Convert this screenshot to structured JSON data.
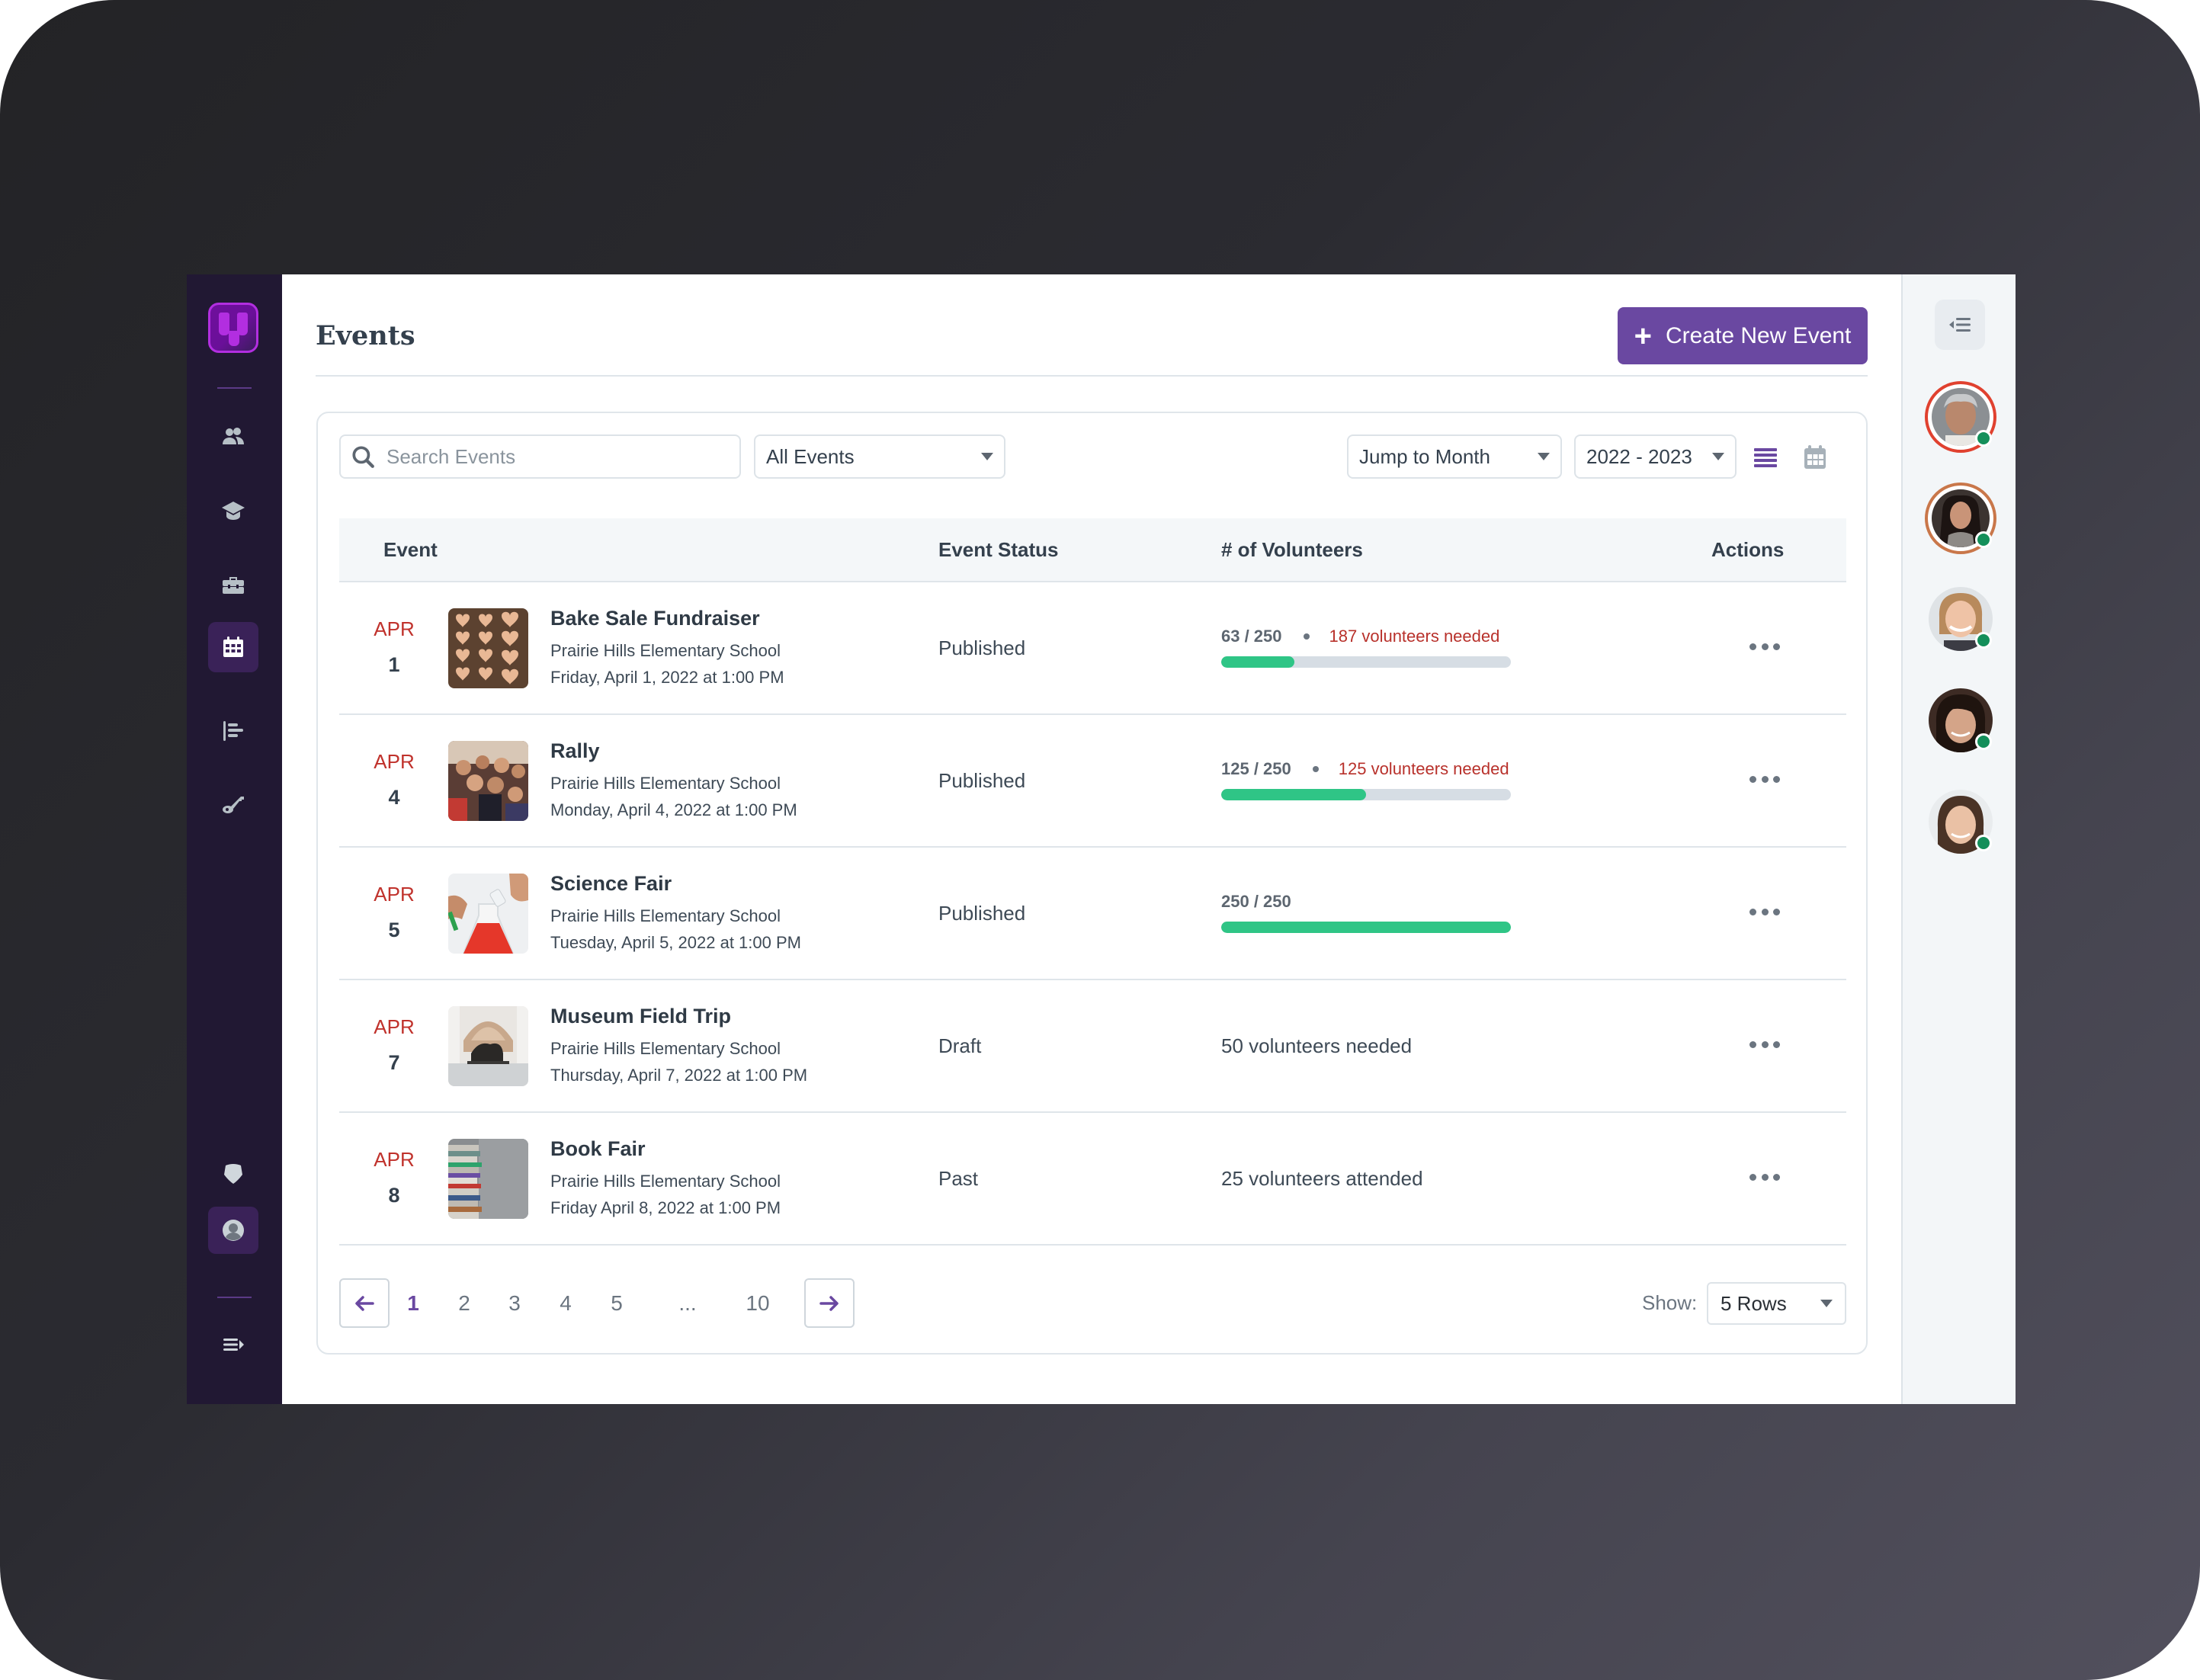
{
  "colors": {
    "sidebar_bg": "#211833",
    "brand_purple": "#6a48a1",
    "logo_magenta": "#b22ee0",
    "need_red": "#b8312b",
    "progress_green": "#2fc586",
    "online_green": "#148f5a",
    "date_month_red": "#c0322c"
  },
  "sidebar": {
    "logo": "brand-logo",
    "items": [
      {
        "name": "users",
        "icon": "users-icon",
        "active": false
      },
      {
        "name": "education",
        "icon": "graduation-cap-icon",
        "active": false
      },
      {
        "name": "jobs",
        "icon": "briefcase-icon",
        "active": false
      },
      {
        "name": "events",
        "icon": "calendar-icon",
        "active": true
      },
      {
        "name": "reports",
        "icon": "align-left-icon",
        "active": false
      },
      {
        "name": "keys",
        "icon": "key-icon",
        "active": false
      }
    ],
    "bottom_items": [
      {
        "name": "security",
        "icon": "shield-icon"
      },
      {
        "name": "profile",
        "icon": "user-circle-icon",
        "active": true
      },
      {
        "name": "expand",
        "icon": "expand-menu-icon"
      }
    ]
  },
  "header": {
    "title": "Events",
    "create_button": "Create New Event"
  },
  "toolbar": {
    "search_placeholder": "Search Events",
    "search_value": "",
    "filter_selected": "All Events",
    "jump_month": "Jump to Month",
    "year_selected": "2022 - 2023",
    "view_list": "list-view-icon",
    "view_calendar": "calendar-view-icon",
    "active_view": "list"
  },
  "table": {
    "columns": [
      "Event",
      "Event Status",
      "# of Volunteers",
      "Actions"
    ],
    "rows": [
      {
        "month": "APR",
        "day": "1",
        "title": "Bake Sale Fundraiser",
        "location": "Prairie Hills Elementary School",
        "when": "Friday, April 1, 2022 at 1:00 PM",
        "status": "Published",
        "volunteers": {
          "filled": 63,
          "total": 250,
          "count_label": "63 / 250",
          "need_label": "187 volunteers needed",
          "progress": 0.252
        },
        "thumb": "bake-sale-thumbnail"
      },
      {
        "month": "APR",
        "day": "4",
        "title": "Rally",
        "location": "Prairie Hills Elementary School",
        "when": "Monday, April 4, 2022 at 1:00 PM",
        "status": "Published",
        "volunteers": {
          "filled": 125,
          "total": 250,
          "count_label": "125 / 250",
          "need_label": "125 volunteers needed",
          "progress": 0.5
        },
        "thumb": "rally-thumbnail"
      },
      {
        "month": "APR",
        "day": "5",
        "title": "Science Fair",
        "location": "Prairie Hills Elementary School",
        "when": "Tuesday, April 5, 2022 at 1:00 PM",
        "status": "Published",
        "volunteers": {
          "filled": 250,
          "total": 250,
          "count_label": "250 / 250",
          "need_label": "",
          "progress": 1.0
        },
        "thumb": "science-fair-thumbnail"
      },
      {
        "month": "APR",
        "day": "7",
        "title": "Museum Field Trip",
        "location": "Prairie Hills Elementary School",
        "when": "Thursday, April 7, 2022 at 1:00 PM",
        "status": "Draft",
        "volunteers_text": "50 volunteers needed",
        "thumb": "museum-thumbnail"
      },
      {
        "month": "APR",
        "day": "8",
        "title": "Book Fair",
        "location": "Prairie Hills Elementary School",
        "when": "Friday April 8, 2022 at 1:00 PM",
        "status": "Past",
        "volunteers_text": "25 volunteers attended",
        "thumb": "book-fair-thumbnail"
      }
    ]
  },
  "pagination": {
    "pages": [
      "1",
      "2",
      "3",
      "4",
      "5",
      "...",
      "10"
    ],
    "current": "1",
    "show_label": "Show:",
    "rows_selected": "5 Rows"
  },
  "right_panel": {
    "collapse_icon": "collapse-panel-icon",
    "avatars": [
      {
        "name": "user-avatar-1",
        "ring": "#e0412f",
        "online": true
      },
      {
        "name": "user-avatar-2",
        "ring": "#c9774a",
        "online": true
      },
      {
        "name": "user-avatar-3",
        "ring": null,
        "online": true
      },
      {
        "name": "user-avatar-4",
        "ring": null,
        "online": true
      },
      {
        "name": "user-avatar-5",
        "ring": null,
        "online": true
      }
    ]
  }
}
